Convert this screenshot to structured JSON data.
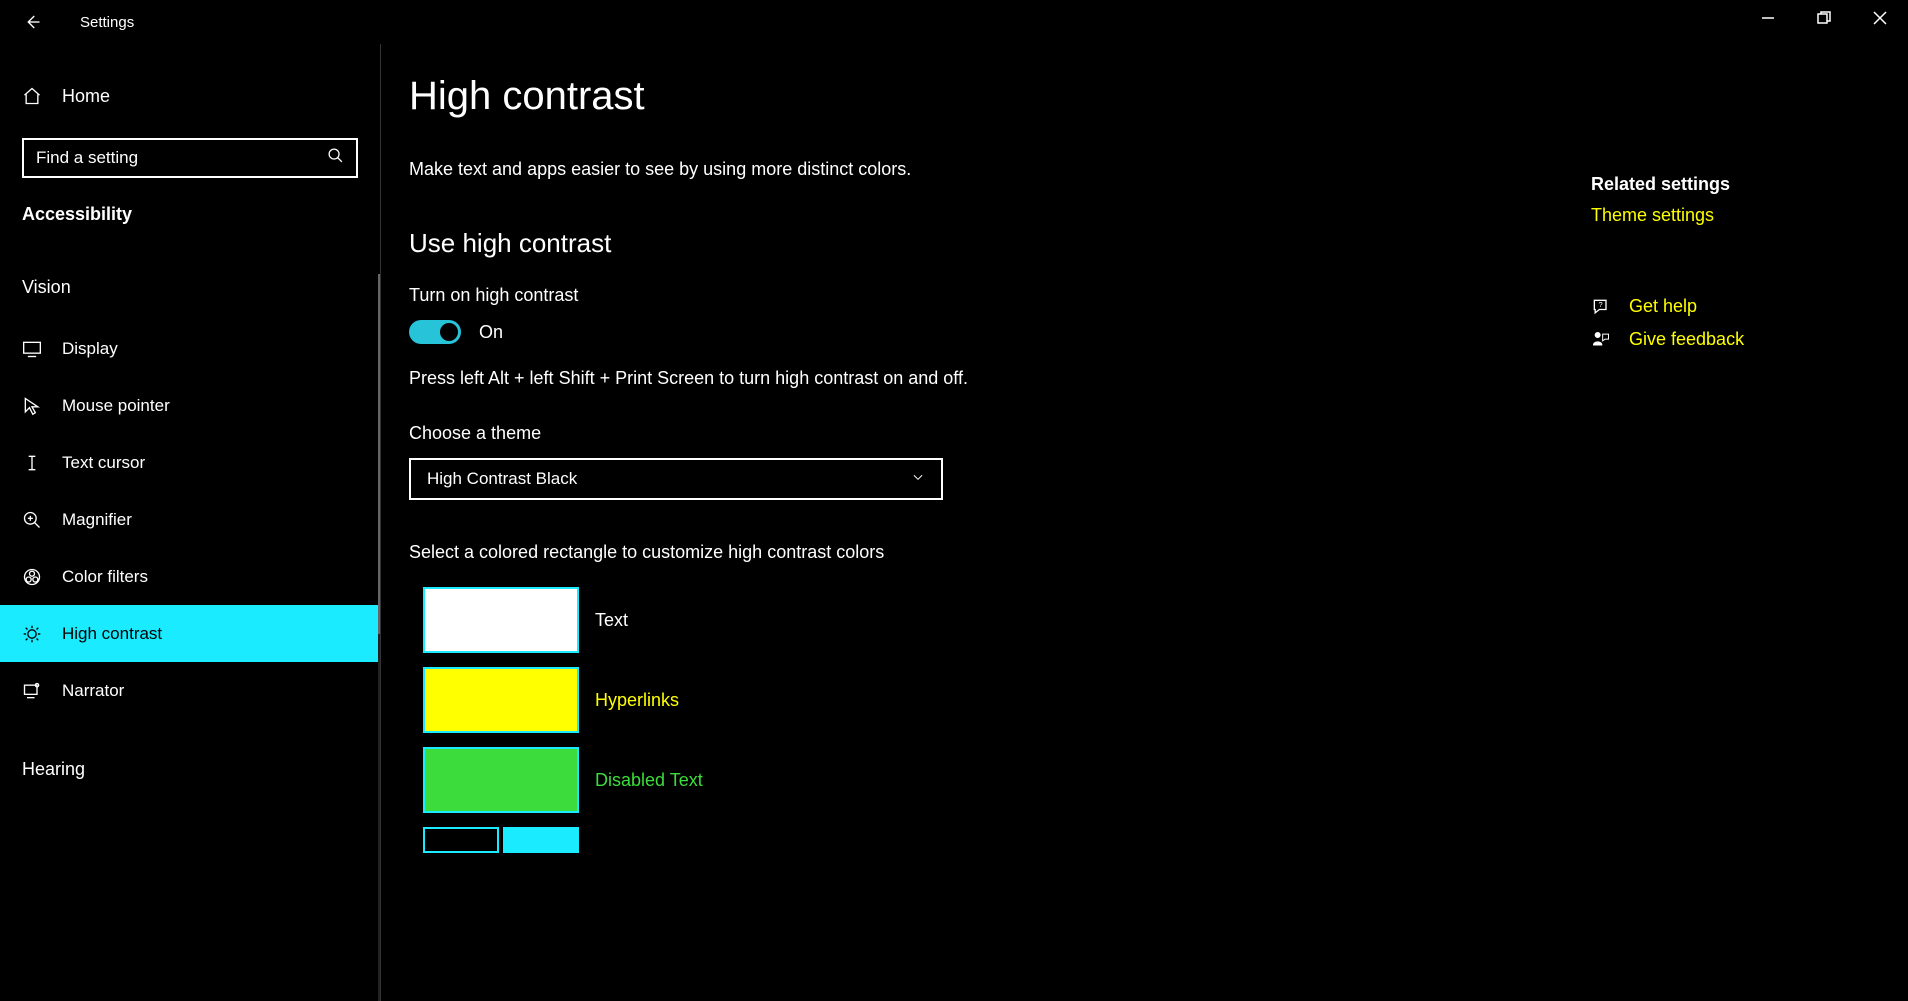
{
  "window": {
    "app_title": "Settings"
  },
  "sidebar": {
    "home_label": "Home",
    "search_placeholder": "Find a setting",
    "group_heading": "Accessibility",
    "categories": {
      "vision": "Vision",
      "hearing": "Hearing"
    },
    "items": {
      "display": "Display",
      "mouse_pointer": "Mouse pointer",
      "text_cursor": "Text cursor",
      "magnifier": "Magnifier",
      "color_filters": "Color filters",
      "high_contrast": "High contrast",
      "narrator": "Narrator"
    }
  },
  "main": {
    "page_title": "High contrast",
    "description": "Make text and apps easier to see by using more distinct colors.",
    "section_heading": "Use high contrast",
    "toggle_label": "Turn on high contrast",
    "toggle_state_label": "On",
    "toggle_on": true,
    "shortcut_hint": "Press left Alt + left Shift + Print Screen to turn high contrast on and off.",
    "choose_theme_label": "Choose a theme",
    "theme_value": "High Contrast Black",
    "customize_hint": "Select a colored rectangle to customize high contrast colors",
    "colors": {
      "text": {
        "label": "Text",
        "hex": "#ffffff"
      },
      "hyperlinks": {
        "label": "Hyperlinks",
        "hex": "#ffff00"
      },
      "disabled_text": {
        "label": "Disabled Text",
        "hex": "#3cdc3c"
      }
    }
  },
  "related": {
    "heading": "Related settings",
    "theme_settings": "Theme settings",
    "get_help": "Get help",
    "give_feedback": "Give feedback"
  }
}
